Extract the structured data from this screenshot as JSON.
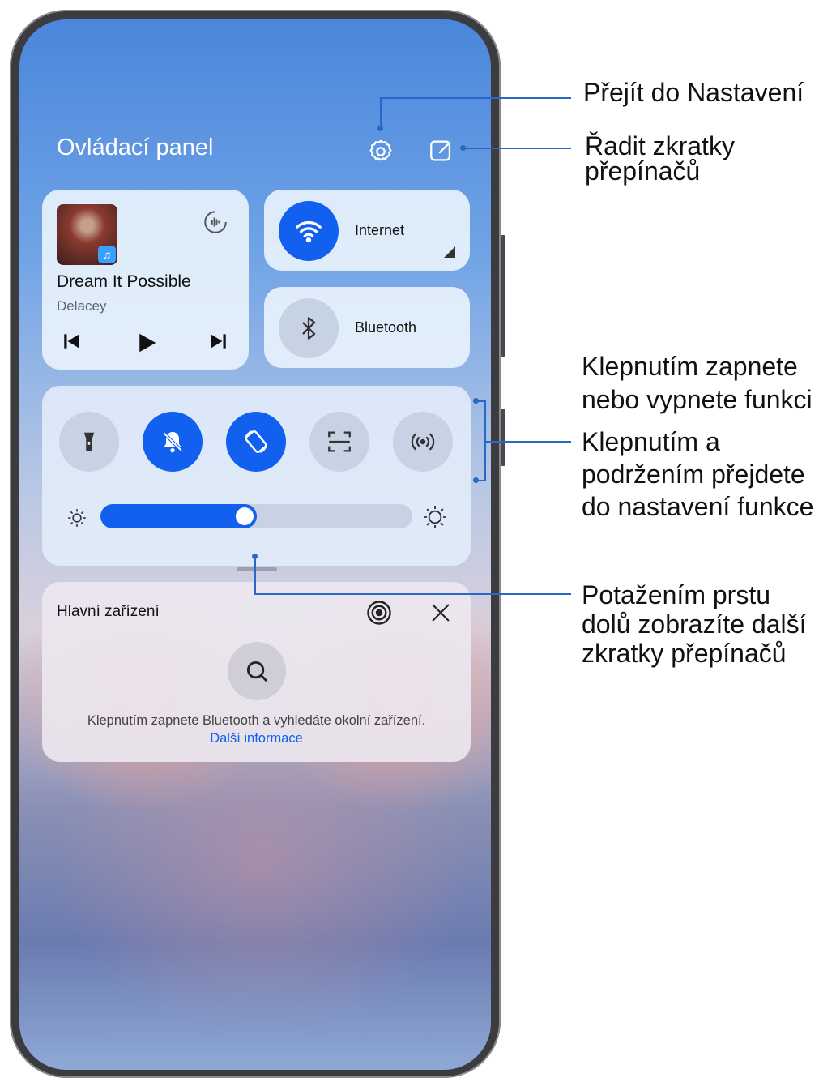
{
  "panel": {
    "title": "Ovládací panel",
    "settings_icon": "gear-icon",
    "edit_icon": "edit-icon"
  },
  "music": {
    "song": "Dream It Possible",
    "artist": "Delacey",
    "controls": [
      "previous-icon",
      "play-icon",
      "next-icon"
    ],
    "audio_icon": "audio-output-icon"
  },
  "tiles": {
    "internet_label": "Internet",
    "bluetooth_label": "Bluetooth"
  },
  "quick_switches": [
    {
      "name": "flashlight-icon",
      "on": false
    },
    {
      "name": "silent-icon",
      "on": true
    },
    {
      "name": "auto-rotate-icon",
      "on": true
    },
    {
      "name": "scan-icon",
      "on": false
    },
    {
      "name": "nfc-icon",
      "on": false
    }
  ],
  "brightness": {
    "level": 0.5
  },
  "devices": {
    "title": "Hlavní zařízení",
    "hint_text": "Klepnutím zapnete Bluetooth a vyhledáte okolní zařízení.",
    "hint_link": "Další informace"
  },
  "annotations": {
    "settings": "Přejít do Nastavení",
    "sort_line1": "Řadit zkratky",
    "sort_line2": "přepínačů",
    "toggle_line1": "Klepnutím zapnete",
    "toggle_line2": "nebo vypnete funkci",
    "hold_line1": "Klepnutím a",
    "hold_line2": "podržením přejdete",
    "hold_line3": "do nastavení funkce",
    "swipe_line1": "Potažením prstu",
    "swipe_line2": "dolů zobrazíte další",
    "swipe_line3": "zkratky přepínačů"
  },
  "colors": {
    "accent": "#1160f0",
    "annotation_line": "#2a68c8"
  }
}
